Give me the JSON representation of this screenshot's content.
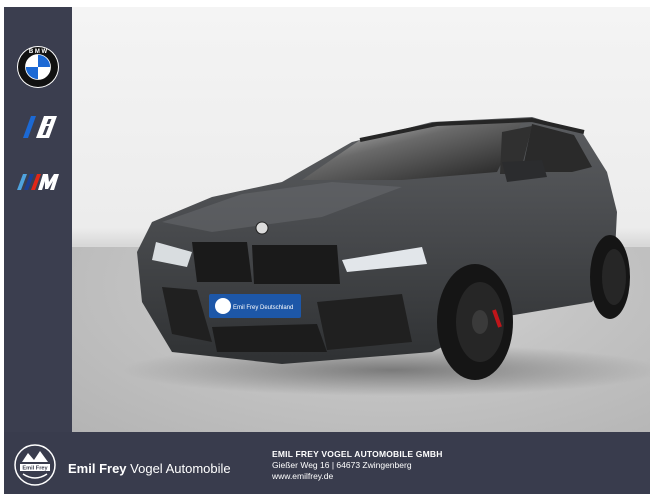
{
  "brand_rail": {
    "logos": [
      {
        "icon": "bmw-roundel-icon",
        "text": "BMW"
      },
      {
        "icon": "bmw-i-icon",
        "text": "i"
      },
      {
        "icon": "bmw-m-icon",
        "text": "M"
      }
    ]
  },
  "photo": {
    "plate_text": "Emil Frey Deutschland"
  },
  "footer": {
    "emblem_text": "Emil Frey",
    "brand_bold": "Emil Frey",
    "brand_light": "Vogel Automobile",
    "company": "EMIL FREY VOGEL AUTOMOBILE GMBH",
    "address": "Gießer Weg 16 | 64673 Zwingenberg",
    "website": "www.emilfrey.de"
  },
  "colors": {
    "rail": "#3b3e4f",
    "footer": "#393c4d",
    "bmw_blue": "#1c69d4",
    "m_light_blue": "#4fa3de",
    "m_dark_blue": "#1c3f94",
    "m_red": "#e22718",
    "car_body": "#4a4c4e"
  }
}
